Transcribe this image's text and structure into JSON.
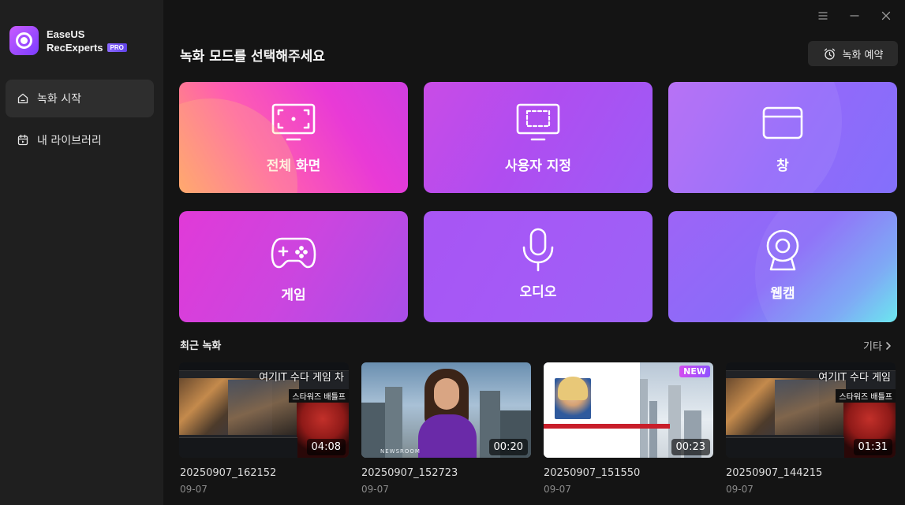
{
  "app": {
    "name_line1": "EaseUS",
    "name_line2": "RecExperts",
    "badge": "PRO",
    "brand_color": "#9b4dff"
  },
  "sidebar": {
    "items": [
      {
        "label": "녹화 시작",
        "icon": "home-icon",
        "active": true
      },
      {
        "label": "내 라이브러리",
        "icon": "library-icon",
        "active": false
      }
    ]
  },
  "window_controls": [
    "menu-icon",
    "minimize-icon",
    "close-icon"
  ],
  "main": {
    "title": "녹화 모드를 선택해주세요",
    "schedule_button": "녹화 예약",
    "modes": [
      {
        "label": "전체 화면",
        "icon": "fullscreen-monitor-icon"
      },
      {
        "label": "사용자 지정",
        "icon": "custom-region-monitor-icon"
      },
      {
        "label": "창",
        "icon": "window-icon"
      },
      {
        "label": "게임",
        "icon": "gamepad-icon"
      },
      {
        "label": "오디오",
        "icon": "microphone-icon"
      },
      {
        "label": "웹캠",
        "icon": "webcam-icon"
      }
    ]
  },
  "recent": {
    "title": "최근 녹화",
    "more_label": "기타",
    "recordings": [
      {
        "name": "20250907_162152",
        "date": "09-07",
        "duration": "04:08",
        "overlay_text": "여기IT 수다 게임 차",
        "overlay_tag": "스타워즈 배틀프",
        "is_new": false
      },
      {
        "name": "20250907_152723",
        "date": "09-07",
        "duration": "00:20",
        "overlay_text": "NEWSROOM",
        "is_new": false
      },
      {
        "name": "20250907_151550",
        "date": "09-07",
        "duration": "00:23",
        "badge": "NEW",
        "is_new": true
      },
      {
        "name": "20250907_144215",
        "date": "09-07",
        "duration": "01:31",
        "overlay_text": "여기IT 수다 게임",
        "overlay_tag": "스타워즈 배틀프",
        "is_new": false
      }
    ]
  }
}
